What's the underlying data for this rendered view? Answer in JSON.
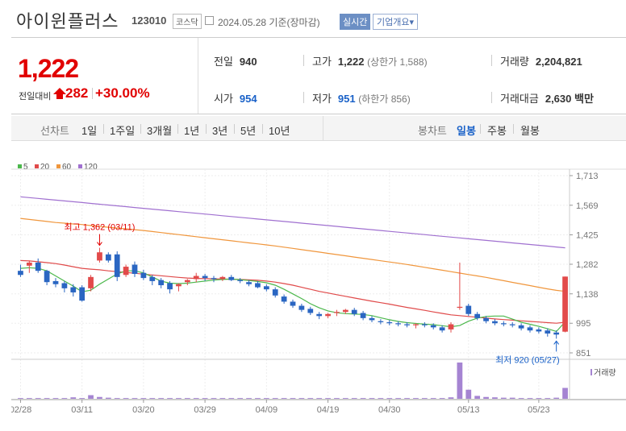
{
  "header": {
    "company": "아이윈플러스",
    "code": "123010",
    "market": "코스닥",
    "date": "2024.05.28",
    "basis": "기준(장마감)",
    "realtime_button": "실시간",
    "corp_info_button": "기업개요",
    "dropdown_mark": "▾"
  },
  "price": {
    "current": "1,222",
    "prev_label": "전일대비",
    "change": "282",
    "change_pct": "+30.00%"
  },
  "summary": {
    "prev_close_label": "전일",
    "prev_close": "940",
    "high_label": "고가",
    "high": "1,222",
    "upper_limit": "(상한가 1,588)",
    "volume_label": "거래량",
    "volume": "2,204,821",
    "open_label": "시가",
    "open": "954",
    "low_label": "저가",
    "low": "951",
    "lower_limit": "(하한가 856)",
    "amount_label": "거래대금",
    "amount": "2,630",
    "amount_unit": "백만"
  },
  "toolbar": {
    "line_chart_label": "선차트",
    "periods": [
      "1일",
      "1주일",
      "3개월",
      "1년",
      "3년",
      "5년",
      "10년"
    ],
    "candle_chart_label": "봉차트",
    "candle_periods": [
      "일봉",
      "주봉",
      "월봉"
    ],
    "active_candle": "일봉"
  },
  "colors": {
    "up": "#e24a4a",
    "down": "#2a66c2",
    "ma5": "#4cb84c",
    "ma20": "#e04a4a",
    "ma60": "#f0963c",
    "ma120": "#a070d0",
    "volume": "#a584d2"
  },
  "chart_data": {
    "type": "candlestick",
    "legend": [
      "5",
      "20",
      "60",
      "120"
    ],
    "y_ticks": [
      1713,
      1569,
      1425,
      1282,
      1138,
      995,
      851
    ],
    "y_tick_labels": [
      "1,713",
      "1,569",
      "1,425",
      "1,282",
      "1,138",
      "995",
      "851"
    ],
    "ylim": [
      851,
      1713
    ],
    "x_tick_labels": [
      "02/28",
      "03/11",
      "03/20",
      "03/29",
      "04/09",
      "04/19",
      "04/30",
      "05/13",
      "05/23"
    ],
    "x_tick_index": [
      0,
      7,
      14,
      21,
      28,
      35,
      42,
      51,
      59
    ],
    "annotation_high": "최고 1,362 (03/11)",
    "annotation_low": "최저 920 (05/27)",
    "volume_label": "거래량",
    "candles": [
      [
        1250,
        1280,
        1220,
        1230
      ],
      [
        1275,
        1300,
        1240,
        1290
      ],
      [
        1290,
        1310,
        1240,
        1250
      ],
      [
        1250,
        1255,
        1180,
        1195
      ],
      [
        1200,
        1215,
        1170,
        1185
      ],
      [
        1190,
        1200,
        1145,
        1165
      ],
      [
        1170,
        1185,
        1125,
        1145
      ],
      [
        1170,
        1180,
        1100,
        1105
      ],
      [
        1165,
        1230,
        1150,
        1220
      ],
      [
        1300,
        1362,
        1290,
        1340
      ],
      [
        1330,
        1340,
        1290,
        1300
      ],
      [
        1330,
        1345,
        1200,
        1220
      ],
      [
        1230,
        1280,
        1220,
        1270
      ],
      [
        1280,
        1295,
        1220,
        1235
      ],
      [
        1240,
        1255,
        1205,
        1215
      ],
      [
        1220,
        1230,
        1180,
        1200
      ],
      [
        1205,
        1215,
        1165,
        1180
      ],
      [
        1190,
        1200,
        1140,
        1160
      ],
      [
        1175,
        1190,
        1150,
        1185
      ],
      [
        1195,
        1210,
        1180,
        1205
      ],
      [
        1210,
        1240,
        1195,
        1225
      ],
      [
        1225,
        1235,
        1200,
        1215
      ],
      [
        1215,
        1225,
        1195,
        1210
      ],
      [
        1210,
        1225,
        1200,
        1220
      ],
      [
        1220,
        1230,
        1200,
        1205
      ],
      [
        1205,
        1215,
        1190,
        1200
      ],
      [
        1195,
        1205,
        1175,
        1185
      ],
      [
        1190,
        1200,
        1165,
        1170
      ],
      [
        1175,
        1185,
        1150,
        1160
      ],
      [
        1160,
        1170,
        1120,
        1130
      ],
      [
        1125,
        1135,
        1090,
        1100
      ],
      [
        1100,
        1110,
        1070,
        1080
      ],
      [
        1080,
        1090,
        1050,
        1060
      ],
      [
        1065,
        1075,
        1035,
        1045
      ],
      [
        1040,
        1050,
        1015,
        1030
      ],
      [
        1030,
        1045,
        1020,
        1040
      ],
      [
        1045,
        1060,
        1030,
        1050
      ],
      [
        1050,
        1065,
        1040,
        1060
      ],
      [
        1060,
        1070,
        1030,
        1040
      ],
      [
        1045,
        1055,
        1010,
        1020
      ],
      [
        1020,
        1030,
        1000,
        1010
      ],
      [
        1005,
        1015,
        990,
        1000
      ],
      [
        1000,
        1010,
        985,
        995
      ],
      [
        995,
        1005,
        980,
        990
      ],
      [
        990,
        1000,
        975,
        985
      ],
      [
        985,
        995,
        970,
        990
      ],
      [
        990,
        1000,
        975,
        985
      ],
      [
        985,
        995,
        965,
        975
      ],
      [
        975,
        985,
        950,
        960
      ],
      [
        965,
        1000,
        950,
        990
      ],
      [
        1070,
        1290,
        1060,
        1075
      ],
      [
        1080,
        1090,
        1030,
        1040
      ],
      [
        1040,
        1050,
        1010,
        1020
      ],
      [
        1020,
        1030,
        995,
        1005
      ],
      [
        1005,
        1015,
        985,
        995
      ],
      [
        995,
        1005,
        980,
        990
      ],
      [
        990,
        1000,
        975,
        985
      ],
      [
        985,
        995,
        960,
        970
      ],
      [
        975,
        985,
        950,
        960
      ],
      [
        965,
        975,
        945,
        955
      ],
      [
        960,
        970,
        930,
        945
      ],
      [
        950,
        960,
        920,
        940
      ],
      [
        954,
        1222,
        951,
        1222
      ]
    ],
    "volume": [
      0.02,
      0.02,
      0.02,
      0.02,
      0.02,
      0.02,
      0.04,
      0.02,
      0.1,
      0.05,
      0.03,
      0.02,
      0.02,
      0.02,
      0.02,
      0.02,
      0.02,
      0.02,
      0.02,
      0.02,
      0.02,
      0.02,
      0.02,
      0.02,
      0.02,
      0.02,
      0.02,
      0.02,
      0.02,
      0.02,
      0.02,
      0.02,
      0.02,
      0.02,
      0.02,
      0.02,
      0.02,
      0.02,
      0.02,
      0.02,
      0.02,
      0.02,
      0.02,
      0.02,
      0.02,
      0.02,
      0.02,
      0.02,
      0.02,
      0.04,
      1.0,
      0.25,
      0.08,
      0.05,
      0.04,
      0.03,
      0.03,
      0.02,
      0.02,
      0.02,
      0.02,
      0.03,
      0.3
    ],
    "ma5": [
      1262,
      1265,
      1262,
      1250,
      1225,
      1200,
      1176,
      1148,
      1156,
      1185,
      1210,
      1235,
      1250,
      1250,
      1240,
      1220,
      1200,
      1190,
      1188,
      1190,
      1195,
      1200,
      1205,
      1208,
      1210,
      1207,
      1203,
      1198,
      1192,
      1180,
      1160,
      1138,
      1115,
      1090,
      1070,
      1055,
      1046,
      1042,
      1040,
      1038,
      1032,
      1022,
      1012,
      1004,
      998,
      994,
      991,
      988,
      983,
      978,
      984,
      1005,
      1020,
      1028,
      1030,
      1030,
      1015,
      1000,
      990,
      980,
      968,
      955,
      1002
    ],
    "ma20": [
      1300,
      1298,
      1294,
      1290,
      1285,
      1278,
      1270,
      1262,
      1258,
      1255,
      1250,
      1246,
      1242,
      1238,
      1234,
      1230,
      1226,
      1222,
      1218,
      1215,
      1213,
      1212,
      1211,
      1210,
      1209,
      1208,
      1206,
      1204,
      1200,
      1195,
      1188,
      1180,
      1170,
      1160,
      1150,
      1142,
      1134,
      1126,
      1118,
      1110,
      1102,
      1095,
      1088,
      1080,
      1072,
      1065,
      1058,
      1050,
      1043,
      1036,
      1032,
      1028,
      1024,
      1020,
      1016,
      1013,
      1010,
      1007,
      1004,
      1001,
      998,
      995,
      1000
    ],
    "ma60": [
      1505,
      1500,
      1495,
      1490,
      1485,
      1482,
      1478,
      1475,
      1470,
      1466,
      1462,
      1458,
      1454,
      1450,
      1446,
      1441,
      1436,
      1431,
      1426,
      1421,
      1416,
      1411,
      1406,
      1401,
      1396,
      1391,
      1386,
      1381,
      1376,
      1371,
      1365,
      1359,
      1353,
      1347,
      1341,
      1335,
      1329,
      1323,
      1317,
      1311,
      1305,
      1299,
      1293,
      1287,
      1281,
      1274,
      1267,
      1260,
      1253,
      1246,
      1239,
      1232,
      1225,
      1218,
      1210,
      1202,
      1194,
      1186,
      1178,
      1170,
      1162,
      1155,
      1150
    ],
    "ma120": [
      1610,
      1606,
      1602,
      1598,
      1594,
      1590,
      1586,
      1582,
      1578,
      1574,
      1570,
      1566,
      1562,
      1558,
      1554,
      1550,
      1546,
      1542,
      1538,
      1534,
      1530,
      1526,
      1522,
      1518,
      1514,
      1510,
      1506,
      1502,
      1498,
      1494,
      1490,
      1486,
      1482,
      1478,
      1474,
      1470,
      1466,
      1462,
      1458,
      1454,
      1450,
      1446,
      1442,
      1438,
      1434,
      1430,
      1426,
      1422,
      1418,
      1414,
      1410,
      1406,
      1402,
      1398,
      1394,
      1390,
      1386,
      1382,
      1378,
      1374,
      1370,
      1366,
      1362
    ]
  }
}
